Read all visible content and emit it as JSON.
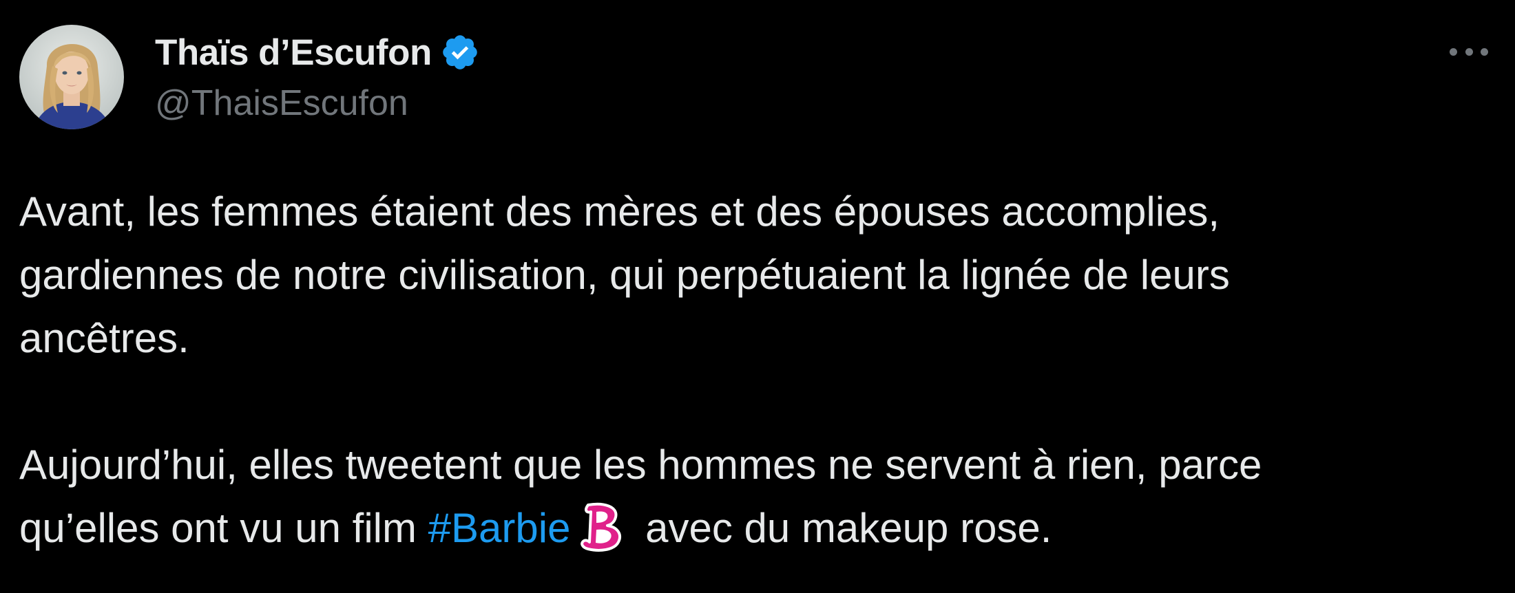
{
  "author": {
    "display_name": "Thaïs d’Escufon",
    "handle": "@ThaisEscufon",
    "verified": true,
    "avatar_icon": "profile-photo"
  },
  "menu": {
    "icon": "more-horizontal-icon"
  },
  "tweet": {
    "paragraph1": {
      "line1": "Avant, les femmes étaient des mères et des épouses accomplies,",
      "line2": "gardiennes de notre civilisation, qui perpétuaient la lignée de leurs",
      "line3": "ancêtres."
    },
    "paragraph2": {
      "line1": "Aujourd’hui, elles tweetent que les hommes ne servent à rien, parce",
      "line2_before": "qu’elles ont vu un film ",
      "hashtag": "#Barbie",
      "hashtag_emoji": "barbie-logo-icon",
      "line2_after": " avec du makeup rose."
    }
  },
  "colors": {
    "background": "#000000",
    "text": "#e7e9ea",
    "secondary": "#71767b",
    "link": "#1d9bf0",
    "verified_badge": "#1d9bf0",
    "barbie_pink": "#e0218a"
  }
}
